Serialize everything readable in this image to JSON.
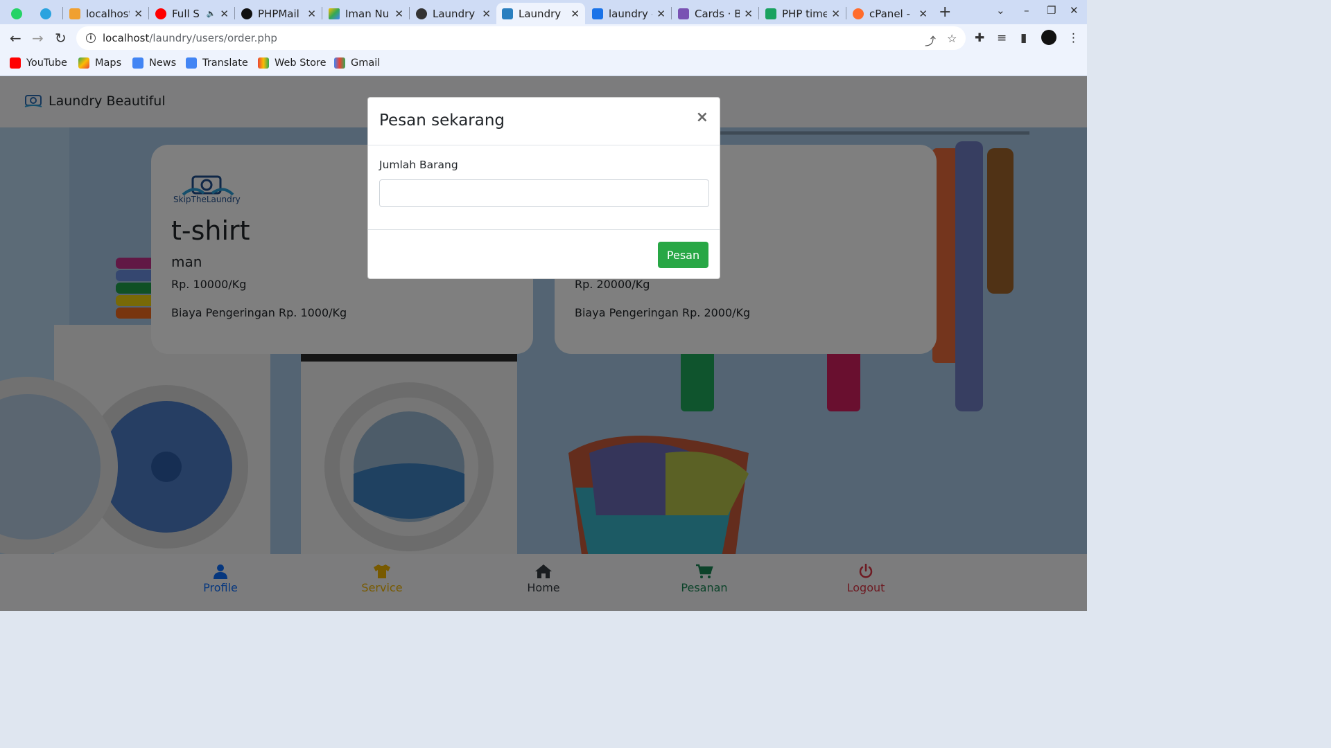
{
  "browser": {
    "tabs": [
      {
        "title": "",
        "favicon": "whatsapp-icon",
        "color": "#25d366"
      },
      {
        "title": "",
        "favicon": "telegram-icon",
        "color": "#2aa3df"
      },
      {
        "title": "localhost",
        "favicon": "phpmyadmin-icon",
        "color": "#f0a030"
      },
      {
        "title": "Full S",
        "favicon": "youtube-icon",
        "color": "#ff0000",
        "audio": "🔈"
      },
      {
        "title": "PHPMail",
        "favicon": "github-icon",
        "color": "#111111"
      },
      {
        "title": "Iman Nu",
        "favicon": "google-drive-icon",
        "color": "#34a853"
      },
      {
        "title": "Laundry",
        "favicon": "globe-icon",
        "color": "#333333"
      },
      {
        "title": "Laundry",
        "favicon": "laundry-icon",
        "color": "#2a7fbf"
      },
      {
        "title": "laundry -",
        "favicon": "share-icon",
        "color": "#1a73e8"
      },
      {
        "title": "Cards · B",
        "favicon": "bootstrap-icon",
        "color": "#7952b3"
      },
      {
        "title": "PHP time",
        "favicon": "w-icon",
        "color": "#1aa260"
      },
      {
        "title": "cPanel - I",
        "favicon": "cpanel-icon",
        "color": "#ff6c2c"
      }
    ],
    "url_host": "localhost",
    "url_path": "/laundry/users/order.php",
    "bookmarks": [
      "YouTube",
      "Maps",
      "News",
      "Translate",
      "Web Store",
      "Gmail"
    ]
  },
  "navbar": {
    "brand": "Laundry Beautiful"
  },
  "cards": [
    {
      "logo_text": "SkipTheLaundry",
      "title": "t-shirt",
      "subtitle": "man",
      "price": "Rp. 10000/Kg",
      "drying": "Biaya Pengeringan Rp. 1000/Kg"
    },
    {
      "title": "",
      "subtitle": "",
      "price": "Rp. 20000/Kg",
      "drying": "Biaya Pengeringan Rp. 2000/Kg"
    }
  ],
  "bottom_nav": [
    {
      "label": "Profile",
      "icon": "user-icon",
      "color": "#0d6efd"
    },
    {
      "label": "Service",
      "icon": "tshirt-icon",
      "color": "#f0b400"
    },
    {
      "label": "Home",
      "icon": "home-icon",
      "color": "#343a40"
    },
    {
      "label": "Pesanan",
      "icon": "cart-icon",
      "color": "#198754"
    },
    {
      "label": "Logout",
      "icon": "power-icon",
      "color": "#dc3545"
    }
  ],
  "modal": {
    "title": "Pesan sekarang",
    "close": "×",
    "field_label": "Jumlah Barang",
    "field_value": "",
    "submit": "Pesan"
  }
}
